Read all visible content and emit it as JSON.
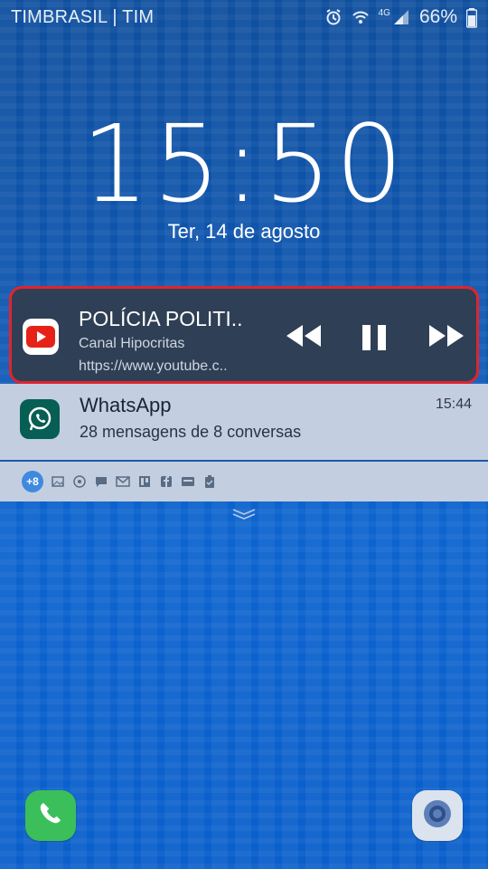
{
  "status_bar": {
    "carrier": "TIMBRASIL | TIM",
    "network_type": "4G",
    "battery": "66%",
    "icons": [
      "alarm-icon",
      "wifi-icon",
      "signal-icon",
      "battery-icon"
    ]
  },
  "lockscreen": {
    "time": "15:50",
    "date": "Ter, 14 de agosto"
  },
  "media_notification": {
    "app_icon": "youtube-icon",
    "title": "POLÍCIA POLITI..",
    "channel": "Canal Hipocritas",
    "url": "https://www.youtube.c..",
    "controls": [
      "rewind-icon",
      "pause-icon",
      "fast-forward-icon"
    ],
    "highlight_color": "#e0242e"
  },
  "whatsapp_notification": {
    "app_icon": "whatsapp-icon",
    "title": "WhatsApp",
    "subtitle": "28 mensagens de 8 conversas",
    "time": "15:44"
  },
  "notification_icons": {
    "more_count": "+8",
    "icons": [
      "gallery-icon",
      "sync-icon",
      "chat-icon",
      "gmail-icon",
      "board-icon",
      "facebook-icon",
      "news-icon",
      "clipboard-icon"
    ]
  },
  "dock": {
    "left": "phone-icon",
    "right": "camera-icon"
  },
  "colors": {
    "background": "#0e57b3",
    "media_card": "#2f3f55",
    "notification_card": "#c3cfe0",
    "whatsapp_green": "#075e54",
    "phone_green": "#3bbf5a"
  }
}
